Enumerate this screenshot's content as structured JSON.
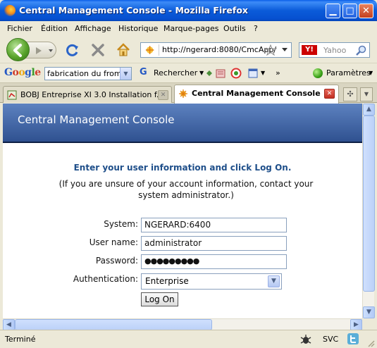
{
  "window": {
    "title": "Central Management Console - Mozilla Firefox"
  },
  "menu": [
    "Fichier",
    "Édition",
    "Affichage",
    "Historique",
    "Marque-pages",
    "Outils",
    "?"
  ],
  "nav": {
    "url": "http://ngerard:8080/CmcApp/",
    "search_placeholder": "Yahoo",
    "search_engine": "Y!"
  },
  "google_bar": {
    "logo": "Google",
    "search_value": "fabrication du froma",
    "search_label": "Rechercher",
    "more": "»",
    "settings": "Paramètres"
  },
  "tabs": [
    {
      "label": "BOBJ Entreprise XI 3.0 Installation f...",
      "active": false
    },
    {
      "label": "Central Management Console",
      "active": true
    }
  ],
  "page": {
    "header": "Central Management Console",
    "prompt": "Enter your user information and click Log On.",
    "hint": "(If you are unsure of your account information, contact your system administrator.)",
    "fields": {
      "system_label": "System:",
      "system_value": "NGERARD:6400",
      "username_label": "User name:",
      "username_value": "administrator",
      "password_label": "Password:",
      "password_value": "●●●●●●●●●",
      "auth_label": "Authentication:",
      "auth_value": "Enterprise"
    },
    "logon_button": "Log On"
  },
  "status": {
    "text": "Terminé",
    "svc": "SVC"
  },
  "colors": {
    "titlebar": "#0b5bd9",
    "cmc_header": "#2f5190",
    "prompt_text": "#1f4f8a"
  }
}
